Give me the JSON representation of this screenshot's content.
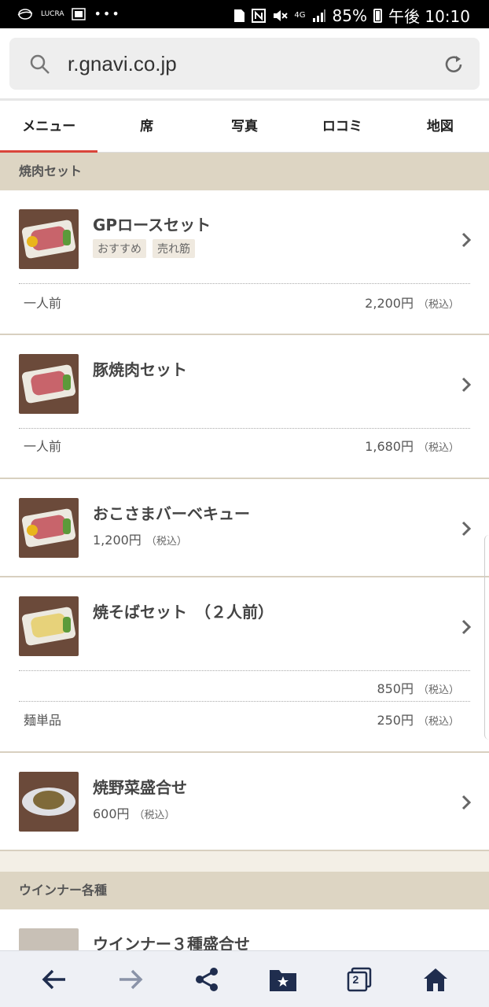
{
  "status_bar": {
    "left_icons": [
      "globe-icon",
      "lucra-icon",
      "photo-icon",
      "more-icon"
    ],
    "lucra_text": "LUCRA",
    "more_text": "•••",
    "battery_percent": "85%",
    "time": "午後 10:10",
    "network": "4G"
  },
  "browser": {
    "url": "r.gnavi.co.jp"
  },
  "tabs": [
    {
      "label": "メニュー",
      "active": true
    },
    {
      "label": "席",
      "active": false
    },
    {
      "label": "写真",
      "active": false
    },
    {
      "label": "ロコミ",
      "active": false
    },
    {
      "label": "地図",
      "active": false
    }
  ],
  "sections": {
    "yakiniku_set": "焼肉セット",
    "wiener": "ウインナー各種"
  },
  "items": {
    "gp_rose": {
      "title": "GPロースセット",
      "badges": [
        "おすすめ",
        "売れ筋"
      ],
      "row_label": "一人前",
      "price": "2,200円",
      "tax": "（税込）"
    },
    "buta": {
      "title": "豚焼肉セット",
      "row_label": "一人前",
      "price": "1,680円",
      "tax": "（税込）"
    },
    "kids_bbq": {
      "title": "おこさまバーベキュー",
      "price": "1,200円",
      "tax": "（税込）"
    },
    "yakisoba": {
      "title": "焼そばセット　（２人前）",
      "price": "850円",
      "tax": "（税込）",
      "row_label": "麺単品",
      "row_price": "250円",
      "row_tax": "（税込）"
    },
    "yasai": {
      "title": "焼野菜盛合せ",
      "price": "600円",
      "tax": "（税込）"
    },
    "wiener3": {
      "title": "ウインナー３種盛合せ"
    }
  },
  "bottom_nav": [
    "back-arrow-icon",
    "forward-arrow-icon",
    "share-icon",
    "bookmarks-icon",
    "tabs-icon",
    "home-icon"
  ],
  "tabs_count": "2",
  "colors": {
    "accent": "#d9453a",
    "section_bg": "#ddd5c3",
    "bottom_nav_icon": "#1f2d4e"
  }
}
